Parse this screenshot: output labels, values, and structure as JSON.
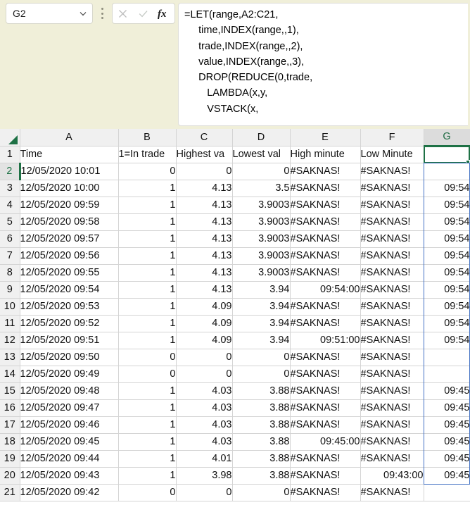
{
  "formula_bar": {
    "name_box_value": "G2",
    "name_box_dropdown_icon": "chevron-down-icon",
    "options_icon": "kebab-menu-icon",
    "cancel_icon": "close-x-icon",
    "confirm_icon": "check-icon",
    "insert_function_icon": "fx-icon",
    "formula_lines": [
      "=LET(range,A2:C21,",
      "     time,INDEX(range,,1),",
      "     trade,INDEX(range,,2),",
      "     value,INDEX(range,,3),",
      "     DROP(REDUCE(0,trade,",
      "        LAMBDA(x,y,",
      "        VSTACK(x,"
    ]
  },
  "grid": {
    "corner_icon": "select-all-triangle-icon",
    "columns": [
      "A",
      "B",
      "C",
      "D",
      "E",
      "F",
      "G"
    ],
    "selected_column": "G",
    "selected_row": "2",
    "selected_cell": "G2",
    "row_numbers": [
      "1",
      "2",
      "3",
      "4",
      "5",
      "6",
      "7",
      "8",
      "9",
      "10",
      "11",
      "12",
      "13",
      "14",
      "15",
      "16",
      "17",
      "18",
      "19",
      "20",
      "21"
    ],
    "headers": {
      "A": "Time",
      "B": "1=In trade",
      "C": "Highest va",
      "D": "Lowest val",
      "E": "High minute",
      "F": "Low Minute",
      "G": ""
    },
    "rows": [
      {
        "n": "1",
        "A": "Time",
        "B": "1=In trade",
        "C": "Highest va",
        "D": "Lowest val",
        "E": "High minute",
        "F": "Low Minute",
        "G": "",
        "header": true
      },
      {
        "n": "2",
        "A": "12/05/2020 10:01",
        "B": "0",
        "C": "0",
        "D": "0",
        "E": "#SAKNAS!",
        "F": "#SAKNAS!",
        "G": ""
      },
      {
        "n": "3",
        "A": "12/05/2020 10:00",
        "B": "1",
        "C": "4.13",
        "D": "3.5",
        "E": "#SAKNAS!",
        "F": "#SAKNAS!",
        "G": "09:54"
      },
      {
        "n": "4",
        "A": "12/05/2020 09:59",
        "B": "1",
        "C": "4.13",
        "D": "3.9003",
        "E": "#SAKNAS!",
        "F": "#SAKNAS!",
        "G": "09:54"
      },
      {
        "n": "5",
        "A": "12/05/2020 09:58",
        "B": "1",
        "C": "4.13",
        "D": "3.9003",
        "E": "#SAKNAS!",
        "F": "#SAKNAS!",
        "G": "09:54"
      },
      {
        "n": "6",
        "A": "12/05/2020 09:57",
        "B": "1",
        "C": "4.13",
        "D": "3.9003",
        "E": "#SAKNAS!",
        "F": "#SAKNAS!",
        "G": "09:54"
      },
      {
        "n": "7",
        "A": "12/05/2020 09:56",
        "B": "1",
        "C": "4.13",
        "D": "3.9003",
        "E": "#SAKNAS!",
        "F": "#SAKNAS!",
        "G": "09:54"
      },
      {
        "n": "8",
        "A": "12/05/2020 09:55",
        "B": "1",
        "C": "4.13",
        "D": "3.9003",
        "E": "#SAKNAS!",
        "F": "#SAKNAS!",
        "G": "09:54"
      },
      {
        "n": "9",
        "A": "12/05/2020 09:54",
        "B": "1",
        "C": "4.13",
        "D": "3.94",
        "E": "09:54:00",
        "F": "#SAKNAS!",
        "G": "09:54"
      },
      {
        "n": "10",
        "A": "12/05/2020 09:53",
        "B": "1",
        "C": "4.09",
        "D": "3.94",
        "E": "#SAKNAS!",
        "F": "#SAKNAS!",
        "G": "09:54"
      },
      {
        "n": "11",
        "A": "12/05/2020 09:52",
        "B": "1",
        "C": "4.09",
        "D": "3.94",
        "E": "#SAKNAS!",
        "F": "#SAKNAS!",
        "G": "09:54"
      },
      {
        "n": "12",
        "A": "12/05/2020 09:51",
        "B": "1",
        "C": "4.09",
        "D": "3.94",
        "E": "09:51:00",
        "F": "#SAKNAS!",
        "G": "09:54"
      },
      {
        "n": "13",
        "A": "12/05/2020 09:50",
        "B": "0",
        "C": "0",
        "D": "0",
        "E": "#SAKNAS!",
        "F": "#SAKNAS!",
        "G": ""
      },
      {
        "n": "14",
        "A": "12/05/2020 09:49",
        "B": "0",
        "C": "0",
        "D": "0",
        "E": "#SAKNAS!",
        "F": "#SAKNAS!",
        "G": ""
      },
      {
        "n": "15",
        "A": "12/05/2020 09:48",
        "B": "1",
        "C": "4.03",
        "D": "3.88",
        "E": "#SAKNAS!",
        "F": "#SAKNAS!",
        "G": "09:45"
      },
      {
        "n": "16",
        "A": "12/05/2020 09:47",
        "B": "1",
        "C": "4.03",
        "D": "3.88",
        "E": "#SAKNAS!",
        "F": "#SAKNAS!",
        "G": "09:45"
      },
      {
        "n": "17",
        "A": "12/05/2020 09:46",
        "B": "1",
        "C": "4.03",
        "D": "3.88",
        "E": "#SAKNAS!",
        "F": "#SAKNAS!",
        "G": "09:45"
      },
      {
        "n": "18",
        "A": "12/05/2020 09:45",
        "B": "1",
        "C": "4.03",
        "D": "3.88",
        "E": "09:45:00",
        "F": "#SAKNAS!",
        "G": "09:45"
      },
      {
        "n": "19",
        "A": "12/05/2020 09:44",
        "B": "1",
        "C": "4.01",
        "D": "3.88",
        "E": "#SAKNAS!",
        "F": "#SAKNAS!",
        "G": "09:45"
      },
      {
        "n": "20",
        "A": "12/05/2020 09:43",
        "B": "1",
        "C": "3.98",
        "D": "3.88",
        "E": "#SAKNAS!",
        "F": "09:43:00",
        "G": "09:45"
      },
      {
        "n": "21",
        "A": "12/05/2020 09:42",
        "B": "0",
        "C": "0",
        "D": "0",
        "E": "#SAKNAS!",
        "F": "#SAKNAS!",
        "G": ""
      }
    ]
  },
  "colors": {
    "accent_green": "#1e7145",
    "spill_blue": "#4472c4",
    "formula_bar_bg": "#f0efd9",
    "header_bg": "#f0f0f0"
  }
}
